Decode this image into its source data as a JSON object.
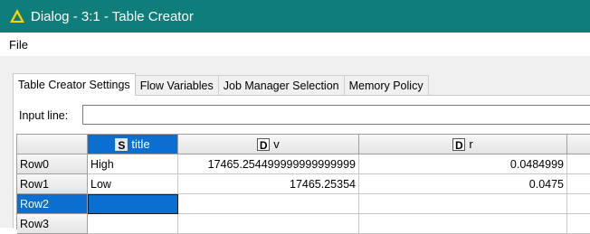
{
  "window": {
    "title": "Dialog - 3:1 - Table Creator"
  },
  "menu": {
    "file": "File"
  },
  "tabs": [
    {
      "label": "Table Creator Settings",
      "active": true
    },
    {
      "label": "Flow Variables",
      "active": false
    },
    {
      "label": "Job Manager Selection",
      "active": false
    },
    {
      "label": "Memory Policy",
      "active": false
    }
  ],
  "input_line": {
    "label": "Input line:",
    "value": ""
  },
  "table": {
    "columns": [
      {
        "type": "S",
        "name": "title"
      },
      {
        "type": "D",
        "name": "v"
      },
      {
        "type": "D",
        "name": "r"
      }
    ],
    "rows": [
      {
        "id": "Row0",
        "cells": [
          "High",
          "17465.254499999999999999",
          "0.0484999"
        ]
      },
      {
        "id": "Row1",
        "cells": [
          "Low",
          "17465.25354",
          "0.0475"
        ]
      },
      {
        "id": "Row2",
        "cells": [
          "",
          "",
          ""
        ]
      },
      {
        "id": "Row3",
        "cells": [
          "",
          "",
          ""
        ]
      }
    ]
  },
  "colors": {
    "titlebar": "#0f7d7a",
    "selection": "#0a6fd0",
    "panel": "#f0f0f0"
  }
}
